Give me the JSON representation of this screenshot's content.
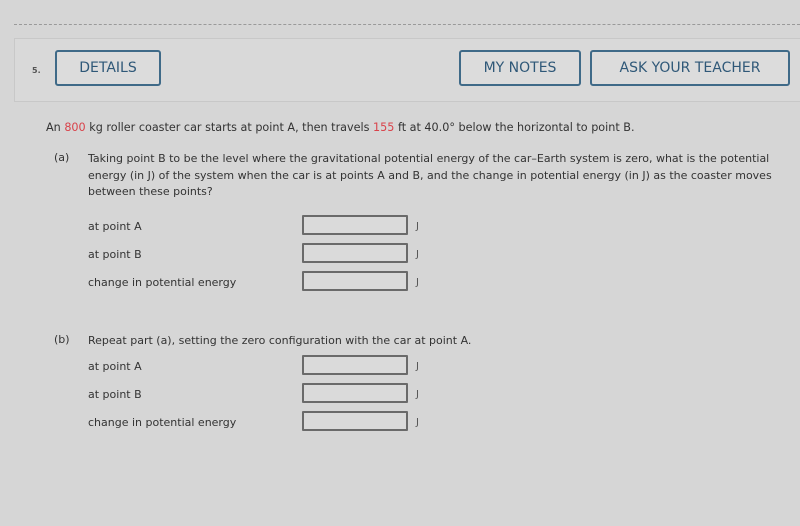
{
  "question": {
    "number": "5.",
    "buttons": {
      "details": "DETAILS",
      "my_notes": "MY NOTES",
      "ask_teacher": "ASK YOUR TEACHER"
    },
    "intro": {
      "pre_mass": "An ",
      "mass": "800",
      "mid": " kg roller coaster car starts at point A, then travels ",
      "distance": "155",
      "post": " ft at 40.0° below the horizontal to point B."
    },
    "highlight_color": "#d9424a",
    "part_a": {
      "letter": "(a)",
      "text": "Taking point B to be the level where the gravitational potential energy of the car–Earth system is zero, what is the potential energy (in J) of the system when the car is at points A and B, and the change in potential energy (in J) as the coaster moves between these points?",
      "rows": [
        {
          "label": "at point A",
          "value": "",
          "unit": "J"
        },
        {
          "label": "at point B",
          "value": "",
          "unit": "J"
        },
        {
          "label": "change in potential energy",
          "value": "",
          "unit": "J"
        }
      ]
    },
    "part_b": {
      "letter": "(b)",
      "text": "Repeat part (a), setting the zero configuration with the car at point A.",
      "rows": [
        {
          "label": "at point A",
          "value": "",
          "unit": "J"
        },
        {
          "label": "at point B",
          "value": "",
          "unit": "J"
        },
        {
          "label": "change in potential energy",
          "value": "",
          "unit": "J"
        }
      ]
    }
  }
}
